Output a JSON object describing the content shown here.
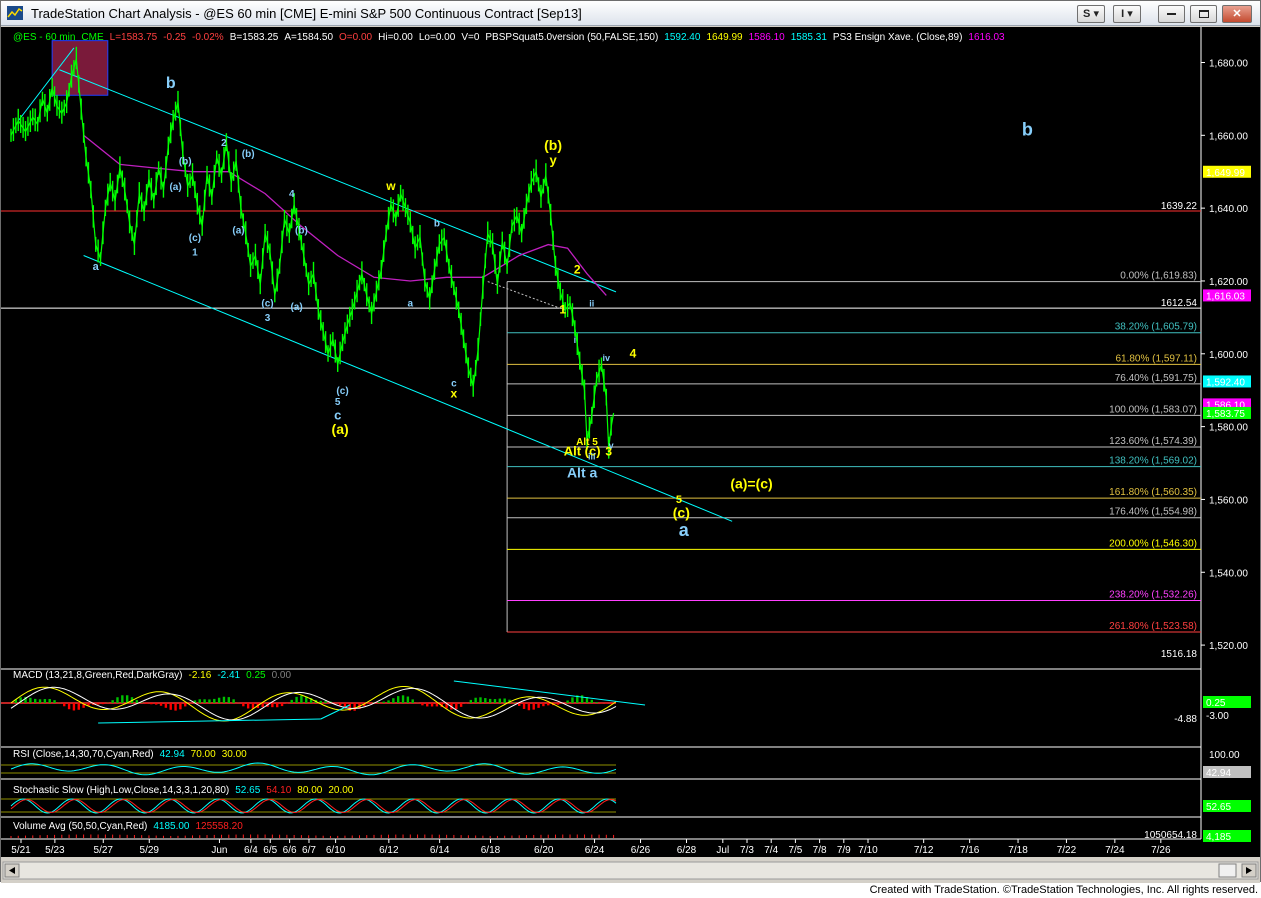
{
  "window": {
    "title": "TradeStation Chart Analysis - @ES 60 min [CME] E-mini S&P 500 Continuous Contract [Sep13]",
    "btn_s": "S",
    "btn_i": "I"
  },
  "header": {
    "symbol": "@ES - 60 min",
    "exchange": "CME",
    "last": "L=1583.75",
    "chg": "-0.25",
    "pct": "-0.02%",
    "bid": "B=1583.25",
    "ask": "A=1584.50",
    "open": "O=0.00",
    "hi": "Hi=0.00",
    "lo": "Lo=0.00",
    "vol": "V=0",
    "study": "PBSPSquat5.0version (50,FALSE,150)",
    "sv1": "1592.40",
    "sv2": "1649.99",
    "sv3": "1586.10",
    "sv4": "1585.31",
    "study2": "PS3 Ensign Xave. (Close,89)",
    "sv5": "1616.03"
  },
  "colors": {
    "price": "#00ff00",
    "cyan": "#00ffff",
    "yellow": "#ffff00",
    "wave_blue": "#87cefa",
    "magenta": "#ff00ff",
    "fib_gray": "#c0c0c0",
    "red": "#ff2020",
    "macd_green": "#00c000",
    "macd_red": "#ff0000"
  },
  "price_axis": {
    "ticks": [
      "1,680.00",
      "1,660.00",
      "1,640.00",
      "1,620.00",
      "1,600.00",
      "1,580.00",
      "1,560.00",
      "1,540.00",
      "1,520.00"
    ],
    "levels": [
      {
        "value": 1680,
        "label": "1,680.00"
      },
      {
        "value": 1660,
        "label": "1,660.00"
      },
      {
        "value": 1640,
        "label": "1,640.00"
      },
      {
        "value": 1620,
        "label": "1,620.00"
      },
      {
        "value": 1600,
        "label": "1,600.00"
      },
      {
        "value": 1580,
        "label": "1,580.00"
      },
      {
        "value": 1560,
        "label": "1,560.00"
      },
      {
        "value": 1540,
        "label": "1,540.00"
      },
      {
        "value": 1520,
        "label": "1,520.00"
      }
    ],
    "tags": [
      {
        "value": 1649.99,
        "label": "1,649.99",
        "bg": "#ffff00",
        "fg": "#000000"
      },
      {
        "value": 1616.03,
        "label": "1,616.03",
        "bg": "#ff00ff",
        "fg": "#000000"
      },
      {
        "value": 1592.4,
        "label": "1,592.40",
        "bg": "#00ffff",
        "fg": "#000000"
      },
      {
        "value": 1586.1,
        "label": "1,586.10",
        "bg": "#ff00ff",
        "fg": "#000000"
      },
      {
        "value": 1583.75,
        "label": "1,583.75",
        "bg": "#00ff00",
        "fg": "#000000"
      }
    ],
    "side_labels": [
      {
        "value": 1639.22,
        "label": "1639.22",
        "color": "#ff4040"
      },
      {
        "value": 1612.54,
        "label": "1612.54",
        "color": "#ffffff"
      },
      {
        "value": 1516.18,
        "label": "1516.18",
        "color": "#ffffff"
      }
    ]
  },
  "fib": {
    "levels": [
      {
        "value": 1619.83,
        "label": "0.00% (1,619.83)",
        "color": "#c0c0c0"
      },
      {
        "value": 1605.79,
        "label": "38.20% (1,605.79)",
        "color": "#40c0c0"
      },
      {
        "value": 1597.11,
        "label": "61.80% (1,597.11)",
        "color": "#e0c040"
      },
      {
        "value": 1591.75,
        "label": "76.40% (1,591.75)",
        "color": "#c0c0c0"
      },
      {
        "value": 1583.07,
        "label": "100.00% (1,583.07)",
        "color": "#c0c0c0"
      },
      {
        "value": 1574.39,
        "label": "123.60% (1,574.39)",
        "color": "#c0c0c0"
      },
      {
        "value": 1569.02,
        "label": "138.20% (1,569.02)",
        "color": "#40c0c0"
      },
      {
        "value": 1560.35,
        "label": "161.80% (1,560.35)",
        "color": "#e0c040"
      },
      {
        "value": 1554.98,
        "label": "176.40% (1,554.98)",
        "color": "#c0c0c0"
      },
      {
        "value": 1546.3,
        "label": "200.00% (1,546.30)",
        "color": "#ffff00"
      },
      {
        "value": 1532.26,
        "label": "238.20% (1,532.26)",
        "color": "#ff40ff"
      },
      {
        "value": 1523.58,
        "label": "261.80% (1,523.58)",
        "color": "#ff4040"
      }
    ]
  },
  "horizontal_lines": [
    {
      "value": 1639.22,
      "color": "#ff3030"
    },
    {
      "value": 1612.54,
      "color": "#ffffff"
    }
  ],
  "date_axis": {
    "labels": [
      "5/21",
      "5/23",
      "5/27",
      "5/29",
      "Jun",
      "6/4",
      "6/5",
      "6/6",
      "6/7",
      "6/10",
      "6/12",
      "6/14",
      "6/18",
      "6/20",
      "6/24",
      "6/26",
      "6/28",
      "Jul",
      "7/3",
      "7/4",
      "7/5",
      "7/8",
      "7/9",
      "7/10",
      "7/12",
      "7/16",
      "7/18",
      "7/22",
      "7/24",
      "7/26"
    ],
    "bar_index": [
      0,
      14,
      34,
      53,
      82,
      95,
      103,
      111,
      119,
      130,
      152,
      173,
      194,
      216,
      237,
      256,
      275,
      290,
      300,
      310,
      320,
      330,
      340,
      350,
      373,
      392,
      412,
      432,
      452,
      471
    ]
  },
  "chart_data": {
    "type": "line",
    "title": "@ES - 60 min",
    "ylim": [
      1516.18,
      1687.0
    ],
    "price_path": [
      [
        0,
        1660
      ],
      [
        3,
        1664
      ],
      [
        6,
        1661
      ],
      [
        9,
        1665
      ],
      [
        11,
        1663
      ],
      [
        13,
        1670
      ],
      [
        15,
        1666
      ],
      [
        17,
        1673
      ],
      [
        19,
        1668
      ],
      [
        21,
        1666
      ],
      [
        23,
        1669
      ],
      [
        25,
        1676
      ],
      [
        27,
        1681
      ],
      [
        29,
        1667
      ],
      [
        31,
        1654
      ],
      [
        33,
        1645
      ],
      [
        35,
        1630
      ],
      [
        37,
        1626
      ],
      [
        39,
        1640
      ],
      [
        41,
        1647
      ],
      [
        43,
        1642
      ],
      [
        45,
        1651
      ],
      [
        47,
        1645
      ],
      [
        49,
        1636
      ],
      [
        51,
        1630
      ],
      [
        53,
        1644
      ],
      [
        55,
        1639
      ],
      [
        57,
        1648
      ],
      [
        59,
        1642
      ],
      [
        61,
        1651
      ],
      [
        63,
        1645
      ],
      [
        65,
        1657
      ],
      [
        67,
        1664
      ],
      [
        69,
        1669
      ],
      [
        71,
        1655
      ],
      [
        73,
        1646
      ],
      [
        75,
        1649
      ],
      [
        77,
        1641
      ],
      [
        79,
        1635
      ],
      [
        81,
        1649
      ],
      [
        83,
        1643
      ],
      [
        85,
        1654
      ],
      [
        87,
        1649
      ],
      [
        89,
        1658
      ],
      [
        91,
        1647
      ],
      [
        93,
        1653
      ],
      [
        95,
        1640
      ],
      [
        97,
        1633
      ],
      [
        99,
        1624
      ],
      [
        101,
        1627
      ],
      [
        103,
        1619
      ],
      [
        105,
        1633
      ],
      [
        107,
        1628
      ],
      [
        109,
        1616
      ],
      [
        111,
        1624
      ],
      [
        113,
        1637
      ],
      [
        115,
        1633
      ],
      [
        117,
        1641
      ],
      [
        119,
        1634
      ],
      [
        121,
        1627
      ],
      [
        123,
        1619
      ],
      [
        125,
        1622
      ],
      [
        127,
        1612
      ],
      [
        129,
        1606
      ],
      [
        131,
        1600
      ],
      [
        133,
        1604
      ],
      [
        135,
        1597
      ],
      [
        137,
        1603
      ],
      [
        139,
        1608
      ],
      [
        141,
        1612
      ],
      [
        143,
        1617
      ],
      [
        145,
        1622
      ],
      [
        147,
        1616
      ],
      [
        149,
        1611
      ],
      [
        151,
        1617
      ],
      [
        153,
        1623
      ],
      [
        155,
        1633
      ],
      [
        157,
        1641
      ],
      [
        159,
        1637
      ],
      [
        161,
        1644
      ],
      [
        163,
        1640
      ],
      [
        165,
        1636
      ],
      [
        167,
        1629
      ],
      [
        169,
        1632
      ],
      [
        171,
        1620
      ],
      [
        173,
        1615
      ],
      [
        175,
        1623
      ],
      [
        177,
        1630
      ],
      [
        179,
        1632
      ],
      [
        181,
        1624
      ],
      [
        183,
        1618
      ],
      [
        185,
        1612
      ],
      [
        187,
        1604
      ],
      [
        189,
        1596
      ],
      [
        191,
        1591
      ],
      [
        193,
        1601
      ],
      [
        195,
        1618
      ],
      [
        197,
        1633
      ],
      [
        199,
        1630
      ],
      [
        201,
        1619
      ],
      [
        203,
        1631
      ],
      [
        205,
        1624
      ],
      [
        207,
        1635
      ],
      [
        209,
        1638
      ],
      [
        211,
        1633
      ],
      [
        213,
        1641
      ],
      [
        215,
        1647
      ],
      [
        217,
        1650
      ],
      [
        219,
        1643
      ],
      [
        221,
        1649
      ],
      [
        223,
        1638
      ],
      [
        225,
        1624
      ],
      [
        227,
        1617
      ],
      [
        229,
        1612
      ],
      [
        231,
        1614
      ],
      [
        233,
        1607
      ],
      [
        235,
        1598
      ],
      [
        237,
        1590
      ],
      [
        238,
        1576
      ],
      [
        240,
        1583
      ],
      [
        242,
        1593
      ],
      [
        244,
        1597
      ],
      [
        246,
        1588
      ],
      [
        247,
        1574
      ],
      [
        248,
        1580
      ],
      [
        249,
        1583.75
      ]
    ],
    "ema_path": [
      [
        30,
        1660
      ],
      [
        45,
        1652
      ],
      [
        60,
        1651
      ],
      [
        75,
        1650
      ],
      [
        90,
        1650
      ],
      [
        105,
        1644
      ],
      [
        120,
        1635
      ],
      [
        135,
        1627
      ],
      [
        150,
        1621
      ],
      [
        165,
        1620
      ],
      [
        180,
        1621
      ],
      [
        195,
        1621
      ],
      [
        210,
        1627
      ],
      [
        222,
        1630
      ],
      [
        230,
        1629
      ],
      [
        238,
        1622
      ],
      [
        246,
        1616.03
      ]
    ],
    "channel": {
      "upper": [
        [
          20,
          1678
        ],
        [
          250,
          1617
        ]
      ],
      "lower": [
        [
          30,
          1627
        ],
        [
          298,
          1554
        ]
      ],
      "left_line": [
        [
          3,
          1664
        ],
        [
          26,
          1684
        ]
      ]
    },
    "fib_box": {
      "x_start": 205,
      "x_end": 250
    },
    "red_box": {
      "x_start": 17,
      "x_end": 40,
      "y_low": 1671,
      "y_high": 1686
    },
    "wave_labels": [
      {
        "text": "b",
        "x": 66,
        "y": 1673,
        "color": "#87cefa",
        "size": 16
      },
      {
        "text": "b",
        "x": 420,
        "y": 1660,
        "color": "#87cefa",
        "size": 18
      },
      {
        "text": "(b)",
        "x": 224,
        "y": 1656,
        "color": "#ffff00",
        "size": 14
      },
      {
        "text": "y",
        "x": 224,
        "y": 1652,
        "color": "#ffff00",
        "size": 13
      },
      {
        "text": "w",
        "x": 157,
        "y": 1645,
        "color": "#ffff00",
        "size": 12
      },
      {
        "text": "(a)",
        "x": 136,
        "y": 1578,
        "color": "#ffff00",
        "size": 14
      },
      {
        "text": "x",
        "x": 183,
        "y": 1588,
        "color": "#ffff00",
        "size": 12
      },
      {
        "text": "2",
        "x": 234,
        "y": 1622,
        "color": "#ffff00",
        "size": 12
      },
      {
        "text": "1",
        "x": 228,
        "y": 1611,
        "color": "#ffff00",
        "size": 12
      },
      {
        "text": "4",
        "x": 257,
        "y": 1599,
        "color": "#ffff00",
        "size": 12
      },
      {
        "text": "3",
        "x": 247,
        "y": 1572,
        "color": "#ffff00",
        "size": 12
      },
      {
        "text": "Alt (c)",
        "x": 236,
        "y": 1572,
        "color": "#ffff00",
        "size": 13
      },
      {
        "text": "Alt 5",
        "x": 238,
        "y": 1575,
        "color": "#ffff00",
        "size": 10
      },
      {
        "text": "Alt a",
        "x": 236,
        "y": 1566,
        "color": "#87cefa",
        "size": 14
      },
      {
        "text": "5",
        "x": 276,
        "y": 1559,
        "color": "#ffff00",
        "size": 11
      },
      {
        "text": "(c)",
        "x": 277,
        "y": 1555,
        "color": "#ffff00",
        "size": 14
      },
      {
        "text": "a",
        "x": 278,
        "y": 1550,
        "color": "#87cefa",
        "size": 18
      },
      {
        "text": "(a)=(c)",
        "x": 306,
        "y": 1563,
        "color": "#ffff00",
        "size": 14
      },
      {
        "text": "a",
        "x": 35,
        "y": 1623,
        "color": "#87cefa",
        "size": 11
      },
      {
        "text": "(b)",
        "x": 72,
        "y": 1652,
        "color": "#87cefa",
        "size": 10
      },
      {
        "text": "(a)",
        "x": 68,
        "y": 1645,
        "color": "#87cefa",
        "size": 10
      },
      {
        "text": "2",
        "x": 88,
        "y": 1657,
        "color": "#87cefa",
        "size": 10
      },
      {
        "text": "(b)",
        "x": 98,
        "y": 1654,
        "color": "#87cefa",
        "size": 10
      },
      {
        "text": "(c)",
        "x": 76,
        "y": 1631,
        "color": "#87cefa",
        "size": 10
      },
      {
        "text": "1",
        "x": 76,
        "y": 1627,
        "color": "#87cefa",
        "size": 10
      },
      {
        "text": "(a)",
        "x": 94,
        "y": 1633,
        "color": "#87cefa",
        "size": 10
      },
      {
        "text": "4",
        "x": 116,
        "y": 1643,
        "color": "#87cefa",
        "size": 10
      },
      {
        "text": "(b)",
        "x": 120,
        "y": 1633,
        "color": "#87cefa",
        "size": 10
      },
      {
        "text": "(c)",
        "x": 106,
        "y": 1613,
        "color": "#87cefa",
        "size": 10
      },
      {
        "text": "3",
        "x": 106,
        "y": 1609,
        "color": "#87cefa",
        "size": 10
      },
      {
        "text": "(a)",
        "x": 118,
        "y": 1612,
        "color": "#87cefa",
        "size": 10
      },
      {
        "text": "(c)",
        "x": 137,
        "y": 1589,
        "color": "#87cefa",
        "size": 10
      },
      {
        "text": "5",
        "x": 135,
        "y": 1586,
        "color": "#87cefa",
        "size": 10
      },
      {
        "text": "c",
        "x": 135,
        "y": 1582,
        "color": "#87cefa",
        "size": 13
      },
      {
        "text": "b",
        "x": 176,
        "y": 1635,
        "color": "#87cefa",
        "size": 10
      },
      {
        "text": "a",
        "x": 165,
        "y": 1613,
        "color": "#87cefa",
        "size": 10
      },
      {
        "text": "c",
        "x": 183,
        "y": 1591,
        "color": "#87cefa",
        "size": 10
      },
      {
        "text": "ii",
        "x": 240,
        "y": 1613,
        "color": "#87cefa",
        "size": 9
      },
      {
        "text": "i",
        "x": 233,
        "y": 1603,
        "color": "#87cefa",
        "size": 9
      },
      {
        "text": "iv",
        "x": 246,
        "y": 1598,
        "color": "#87cefa",
        "size": 9
      },
      {
        "text": "iii",
        "x": 240,
        "y": 1571,
        "color": "#87cefa",
        "size": 9
      },
      {
        "text": "v",
        "x": 248,
        "y": 1574,
        "color": "#87cefa",
        "size": 9
      }
    ]
  },
  "macd": {
    "label": "MACD (13,21,8,Green,Red,DarkGray)",
    "v1": "-2.16",
    "v2": "-2.41",
    "v3": "0.25",
    "v4": "0.00",
    "axis_label": "-4.88",
    "tag_top": "0.25",
    "tag_bottom": "-3.00"
  },
  "rsi": {
    "label": "RSI (Close,14,30,70,Cyan,Red)",
    "v1": "42.94",
    "v2": "70.00",
    "v3": "30.00",
    "axis_label": "100.00",
    "tag": "42.94"
  },
  "stoch": {
    "label": "Stochastic Slow (High,Low,Close,14,3,3,1,20,80)",
    "v1": "52.65",
    "v2": "54.10",
    "v3": "80.00",
    "v4": "20.00",
    "tag": "52.65"
  },
  "volume": {
    "label": "Volume Avg (50,50,Cyan,Red)",
    "v1": "4185.00",
    "v2": "125558.20",
    "axis_label": "1050654.18",
    "tag": "4,185"
  },
  "footer": {
    "text": "Created with TradeStation. ©TradeStation Technologies, Inc. All rights reserved."
  }
}
